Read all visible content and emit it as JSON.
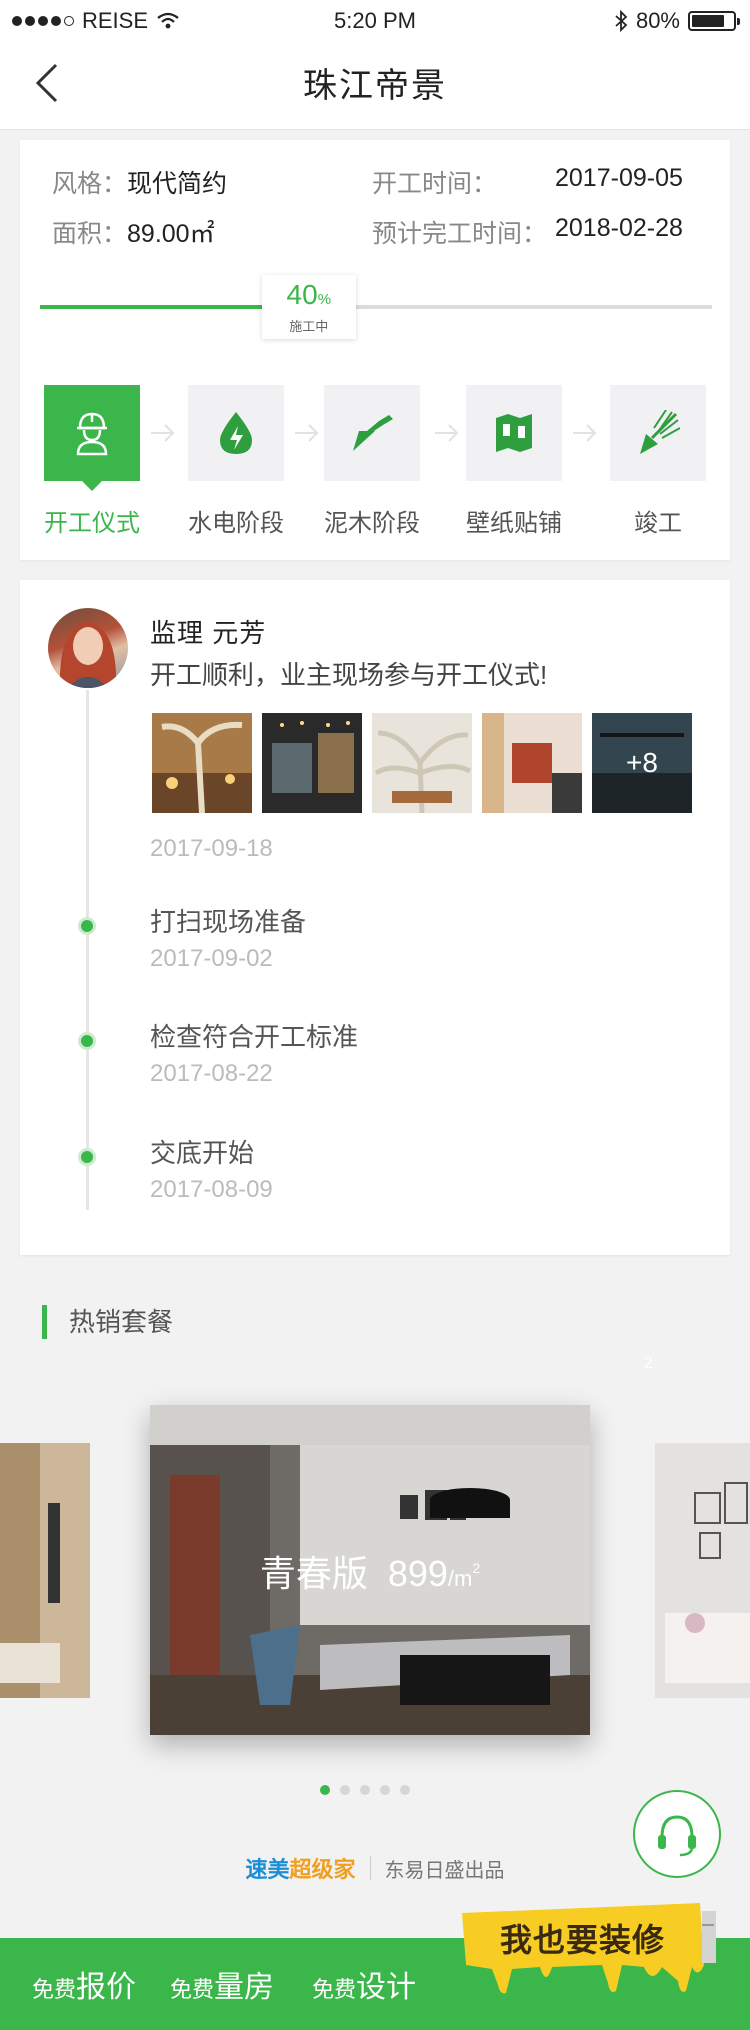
{
  "status": {
    "carrier": "REISE",
    "time": "5:20 PM",
    "battery": "80%"
  },
  "nav": {
    "title": "珠江帝景"
  },
  "project": {
    "style_label": "风格：",
    "style_value": "现代简约",
    "area_label": "面积：",
    "area_value": "89.00㎡",
    "start_label": "开工时间：",
    "start_value": "2017-09-05",
    "finish_label": "预计完工时间：",
    "finish_value": "2018-02-28",
    "progress": {
      "percent": 40,
      "percent_text": "40",
      "percent_unit": "%",
      "status": "施工中"
    },
    "stages": [
      {
        "name": "开工仪式",
        "icon": "worker-icon",
        "active": true
      },
      {
        "name": "水电阶段",
        "icon": "water-electric-icon",
        "active": false
      },
      {
        "name": "泥木阶段",
        "icon": "trowel-icon",
        "active": false
      },
      {
        "name": "壁纸贴铺",
        "icon": "wallpaper-icon",
        "active": false
      },
      {
        "name": "竣工",
        "icon": "broom-icon",
        "active": false
      }
    ]
  },
  "timeline": {
    "post": {
      "author": "监理  元芳",
      "text": "开工顺利，业主现场参与开工仪式!",
      "more_count": "+8",
      "date": "2017-09-18"
    },
    "events": [
      {
        "title": "打扫现场准备",
        "date": "2017-09-02"
      },
      {
        "title": "检查符合开工标准",
        "date": "2017-08-22"
      },
      {
        "title": "交底开始",
        "date": "2017-08-09"
      }
    ]
  },
  "packages": {
    "section_title": "热销套餐",
    "faint_number": "2",
    "main": {
      "name": "青春版",
      "price": "899",
      "unit": "/m",
      "unit_sup": "2"
    },
    "active_page": 1,
    "page_count": 5
  },
  "footer": {
    "brand_a": "速美",
    "brand_b": "超级家",
    "producer": "东易日盛出品",
    "items": [
      {
        "small": "免费",
        "large": "报价"
      },
      {
        "small": "免费",
        "large": "量房"
      },
      {
        "small": "免费",
        "large": "设计"
      }
    ],
    "cta": "我也要装修"
  },
  "colors": {
    "accent": "#3ab64a",
    "cta_yellow": "#f7cd24"
  }
}
